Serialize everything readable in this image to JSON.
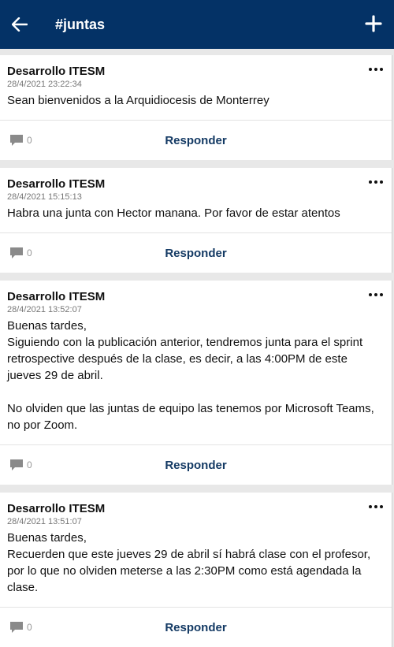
{
  "header": {
    "title": "#juntas"
  },
  "posts": [
    {
      "author": "Desarrollo ITESM",
      "date": "28/4/2021 23:22:34",
      "text": "Sean bienvenidos a la Arquidiocesis de Monterrey",
      "comments": "0",
      "reply": "Responder"
    },
    {
      "author": "Desarrollo ITESM",
      "date": "28/4/2021 15:15:13",
      "text": "Habra una junta con Hector manana. Por favor de estar atentos",
      "comments": "0",
      "reply": "Responder"
    },
    {
      "author": "Desarrollo ITESM",
      "date": "28/4/2021 13:52:07",
      "text": "Buenas tardes,\nSiguiendo con la publicación anterior, tendremos junta para el sprint retrospective después de la clase, es decir, a las 4:00PM de este jueves 29 de abril.\n\nNo olviden que las juntas de equipo las tenemos por Microsoft Teams, no por Zoom.",
      "comments": "0",
      "reply": "Responder"
    },
    {
      "author": "Desarrollo ITESM",
      "date": "28/4/2021 13:51:07",
      "text": "Buenas tardes,\nRecuerden que este jueves 29 de abril sí habrá clase con el profesor, por lo que no olviden meterse a las 2:30PM como está agendada la clase.",
      "comments": "0",
      "reply": "Responder"
    }
  ]
}
